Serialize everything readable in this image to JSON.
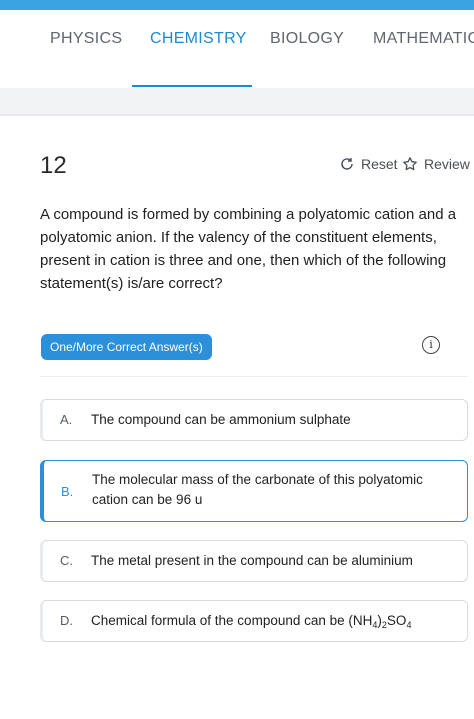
{
  "tabs": [
    {
      "label": "PHYSICS",
      "active": false
    },
    {
      "label": "CHEMISTRY",
      "active": true
    },
    {
      "label": "BIOLOGY",
      "active": false
    },
    {
      "label": "MATHEMATICS",
      "active": false
    }
  ],
  "question": {
    "number": "12",
    "reset_label": "Reset",
    "review_label": "Review",
    "text": "A compound is formed by combining a polyatomic cation and a polyatomic anion. If the valency of the constituent elements, present in cation is three and one, then which of the following statement(s) is/are correct?",
    "answer_type_badge": "One/More Correct Answer(s)",
    "info_icon": "i"
  },
  "options": [
    {
      "letter": "A.",
      "text": "The compound can be ammonium sulphate",
      "selected": false
    },
    {
      "letter": "B.",
      "text": "The molecular mass of the carbonate of this polyatomic cation can be 96 u",
      "selected": true
    },
    {
      "letter": "C.",
      "text": "The metal present in the compound can be aluminium",
      "selected": false
    },
    {
      "letter": "D.",
      "text_prefix": "Chemical formula of the compound can be ",
      "formula": {
        "open": "(NH",
        "sub1": "4",
        "close": ")",
        "sub2": "2",
        "rest": "SO",
        "sub3": "4"
      },
      "selected": false
    }
  ],
  "colors": {
    "accent": "#2b8fd9",
    "tab_active": "#1a8bd1",
    "top_strip": "#3aa3e0"
  },
  "icons": {
    "reset": "refresh-icon",
    "review": "star-outline-icon",
    "info": "info-circle-icon"
  }
}
